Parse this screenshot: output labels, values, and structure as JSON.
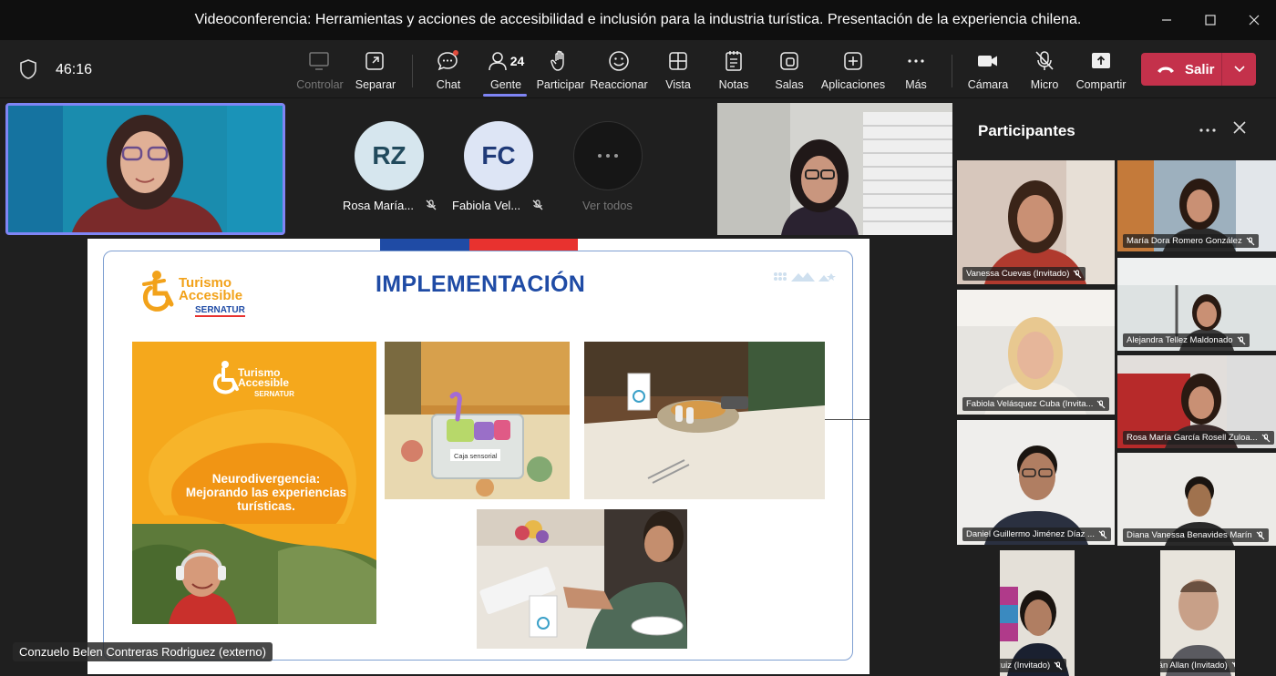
{
  "window": {
    "title": "Videoconferencia: Herramientas y acciones de accesibilidad e inclusión para la industria turística. Presentación de la experiencia chilena."
  },
  "toolbar": {
    "timer": "46:16",
    "controlar": "Controlar",
    "separar": "Separar",
    "chat": "Chat",
    "gente": "Gente",
    "gente_count": "24",
    "participar": "Participar",
    "reaccionar": "Reaccionar",
    "vista": "Vista",
    "notas": "Notas",
    "salas": "Salas",
    "aplicaciones": "Aplicaciones",
    "mas": "Más",
    "camara": "Cámara",
    "micro": "Micro",
    "compartir": "Compartir",
    "salir": "Salir"
  },
  "stage": {
    "participants": [
      {
        "initials": "RZ",
        "name": "Rosa María..."
      },
      {
        "initials": "FC",
        "name": "Fabiola Vel..."
      }
    ],
    "ver_todos": "Ver todos",
    "speaker_label": "Conzuelo Belen Contreras Rodriguez (externo)"
  },
  "slide": {
    "title": "IMPLEMENTACIÓN",
    "logo_line1": "Turismo",
    "logo_line2": "Accesible",
    "logo_brand": "SERNATUR",
    "poster_line1": "Turismo",
    "poster_line2": "Accesible",
    "poster_brand": "SERNATUR",
    "poster_headline": "Neurodivergencia: Mejorando las experiencias turísticas.",
    "box_label": "Caja sensorial"
  },
  "panel": {
    "title": "Participantes",
    "tiles": [
      {
        "name": "Vanessa Cuevas (Invitado)"
      },
      {
        "name": "María Dora Romero González"
      },
      {
        "name": "Alejandra Tellez Maldonado"
      },
      {
        "name": "Fabiola Velásquez Cuba (Invita..."
      },
      {
        "name": "Rosa María García Rosell Zuloa..."
      },
      {
        "name": "Daniel Guillermo Jiménez Díaz ..."
      },
      {
        "name": "Diana Vanessa Benavides Marín"
      },
      {
        "name": "Alexis Ruiz (Invitado)"
      },
      {
        "name": "Sebastián Allan (Invitado)"
      }
    ]
  },
  "colors": {
    "accent": "#7f85f5",
    "leave": "#c4314b",
    "slide_blue": "#1f4ba5",
    "slide_orange": "#f5a81c"
  }
}
